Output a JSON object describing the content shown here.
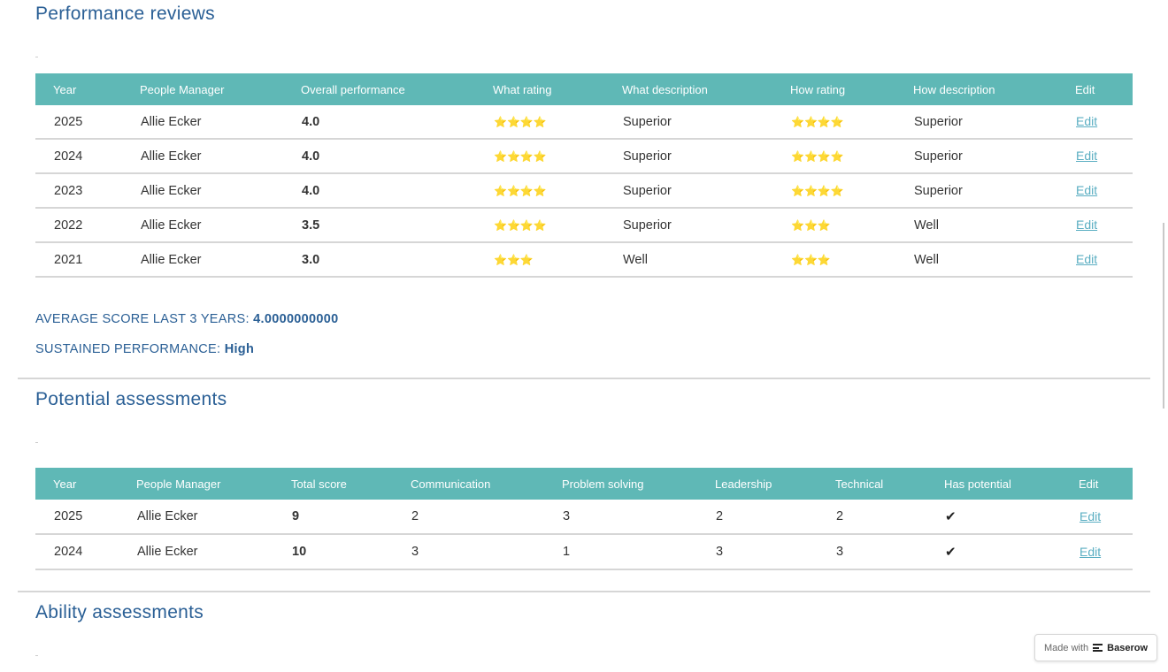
{
  "performance": {
    "title": "Performance reviews",
    "columns": [
      "Year",
      "People Manager",
      "Overall performance",
      "What rating",
      "What description",
      "How rating",
      "How description",
      "Edit"
    ],
    "rows": [
      {
        "year": "2025",
        "manager": "Allie Ecker",
        "overall": "4.0",
        "what_rating": "⭐⭐⭐⭐",
        "what_desc": "Superior",
        "how_rating": "⭐⭐⭐⭐",
        "how_desc": "Superior",
        "edit": "Edit"
      },
      {
        "year": "2024",
        "manager": "Allie Ecker",
        "overall": "4.0",
        "what_rating": "⭐⭐⭐⭐",
        "what_desc": "Superior",
        "how_rating": "⭐⭐⭐⭐",
        "how_desc": "Superior",
        "edit": "Edit"
      },
      {
        "year": "2023",
        "manager": "Allie Ecker",
        "overall": "4.0",
        "what_rating": "⭐⭐⭐⭐",
        "what_desc": "Superior",
        "how_rating": "⭐⭐⭐⭐",
        "how_desc": "Superior",
        "edit": "Edit"
      },
      {
        "year": "2022",
        "manager": "Allie Ecker",
        "overall": "3.5",
        "what_rating": "⭐⭐⭐⭐",
        "what_desc": "Superior",
        "how_rating": "⭐⭐⭐",
        "how_desc": "Well",
        "edit": "Edit"
      },
      {
        "year": "2021",
        "manager": "Allie Ecker",
        "overall": "3.0",
        "what_rating": "⭐⭐⭐",
        "what_desc": "Well",
        "how_rating": "⭐⭐⭐",
        "how_desc": "Well",
        "edit": "Edit"
      }
    ],
    "avg_label": "AVERAGE SCORE LAST 3 YEARS:",
    "avg_value": "4.0000000000",
    "sustained_label": "SUSTAINED PERFORMANCE:",
    "sustained_value": "High"
  },
  "potential": {
    "title": "Potential assessments",
    "columns": [
      "Year",
      "People Manager",
      "Total score",
      "Communication",
      "Problem solving",
      "Leadership",
      "Technical",
      "Has potential",
      "Edit"
    ],
    "rows": [
      {
        "year": "2025",
        "manager": "Allie Ecker",
        "total": "9",
        "communication": "2",
        "problem_solving": "3",
        "leadership": "2",
        "technical": "2",
        "has_potential": "✔",
        "edit": "Edit"
      },
      {
        "year": "2024",
        "manager": "Allie Ecker",
        "total": "10",
        "communication": "3",
        "problem_solving": "1",
        "leadership": "3",
        "technical": "3",
        "has_potential": "✔",
        "edit": "Edit"
      }
    ]
  },
  "ability": {
    "title": "Ability assessments"
  },
  "badge": {
    "made_with": "Made with",
    "brand": "Baserow",
    "icon": "baserow-logo-icon"
  },
  "colors": {
    "header_bg": "#5fb8b6",
    "title": "#2a5f95",
    "link": "#5aaec2"
  }
}
